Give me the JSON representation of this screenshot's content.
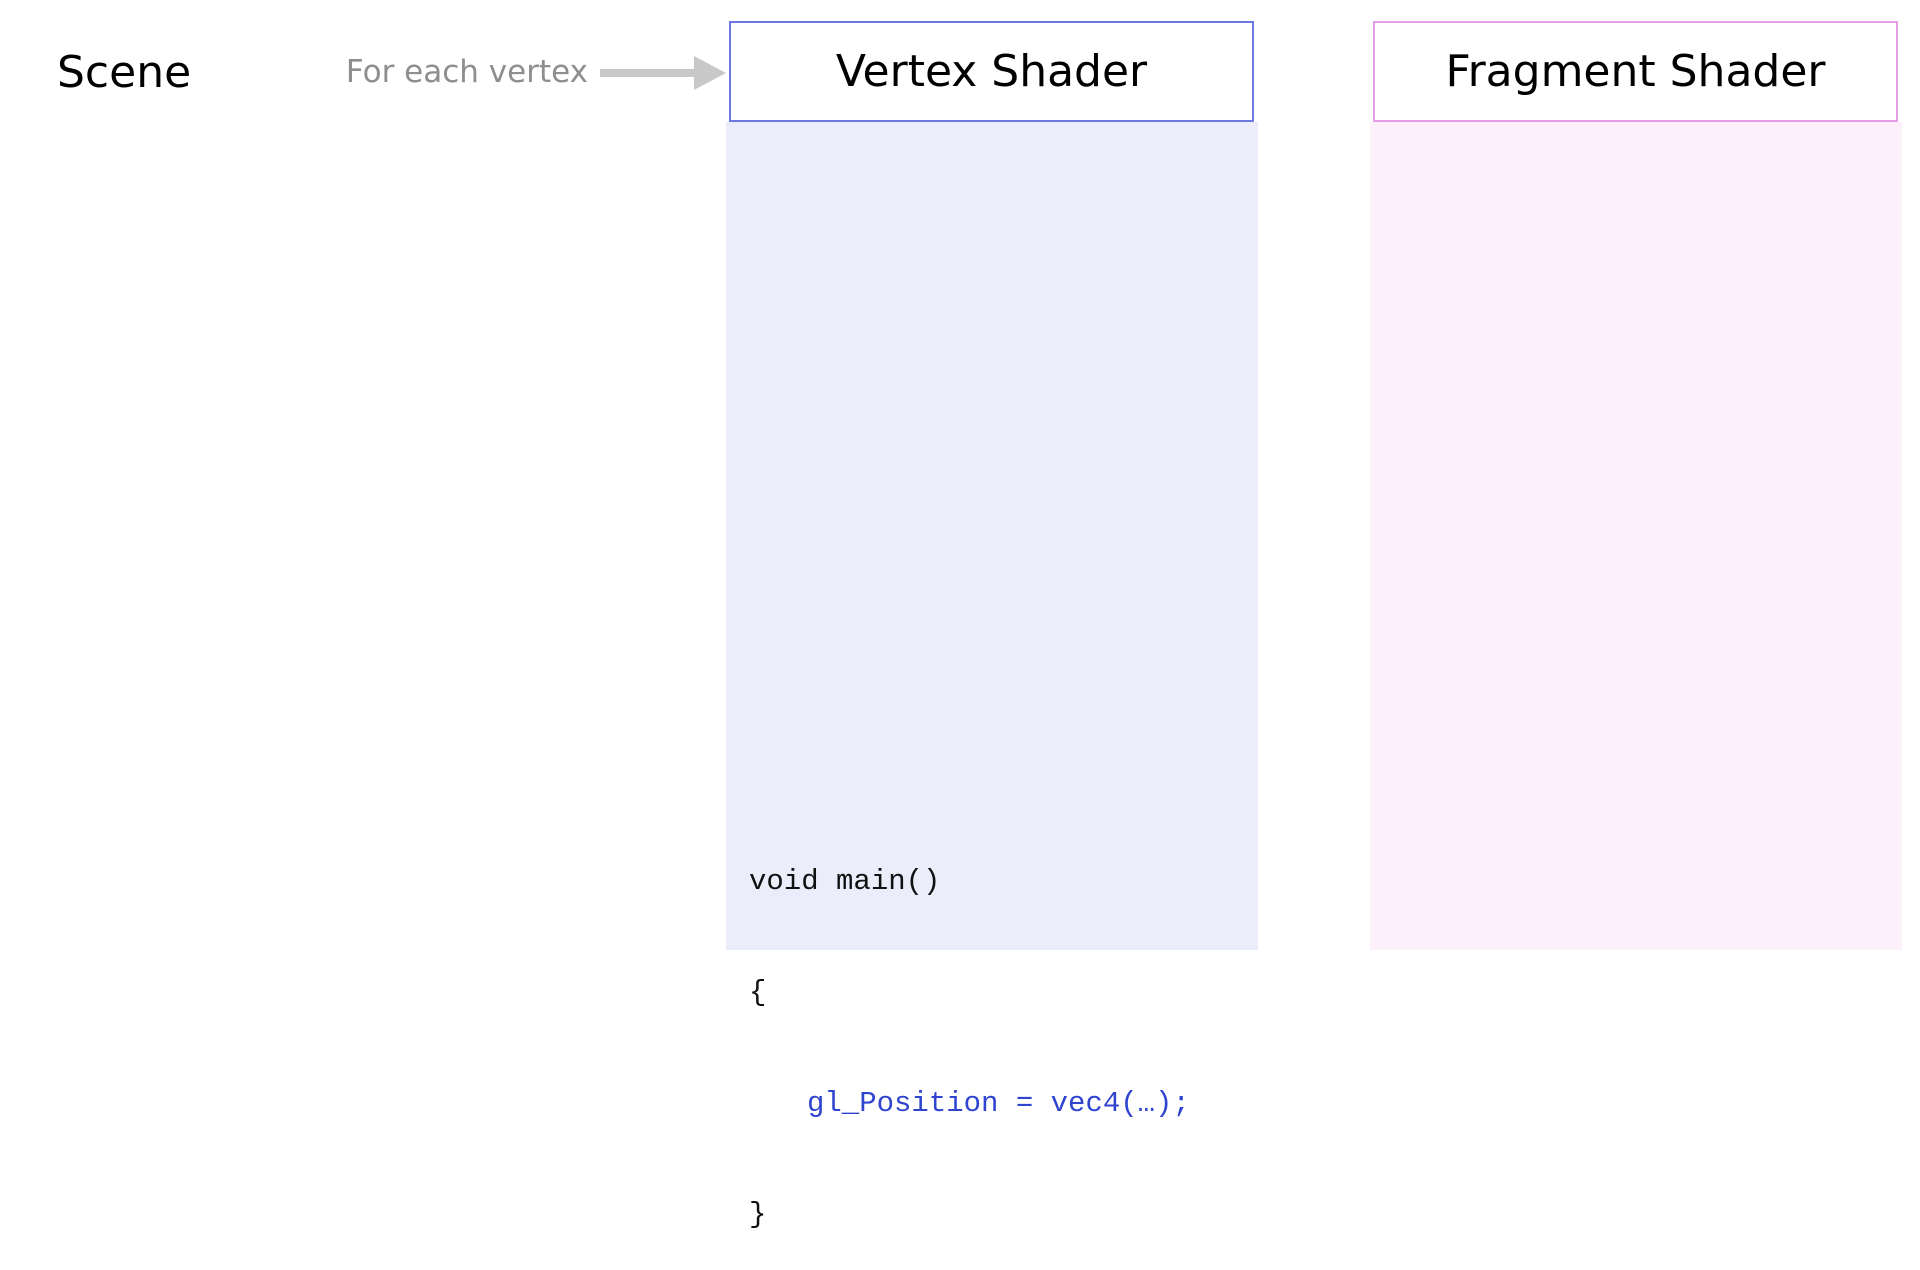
{
  "scene": {
    "label": "Scene"
  },
  "connector": {
    "caption": "For each vertex",
    "arrow_color": "#c8c8c8"
  },
  "vertex_shader": {
    "title": "Vertex Shader",
    "border_color": "#6c78e2",
    "fill_color": "#ebedfb",
    "code": {
      "line1": "void main()",
      "line2": "{",
      "line3": "gl_Position = vec4(…);",
      "line4": "}",
      "highlight_color": "#2f45d0"
    }
  },
  "fragment_shader": {
    "title": "Fragment Shader",
    "border_color": "#e79de6",
    "fill_color": "#fcf0fb"
  }
}
